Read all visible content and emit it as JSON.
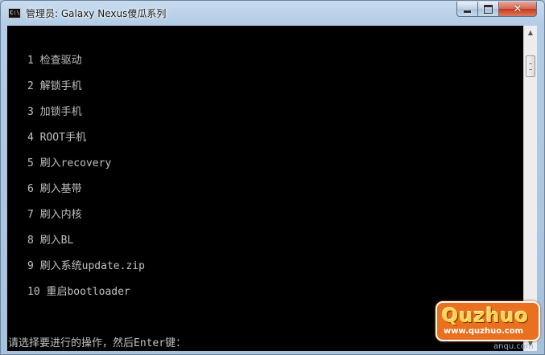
{
  "window": {
    "title": "管理员:  Galaxy Nexus傻瓜系列",
    "controls": {
      "minimize": "minimize",
      "maximize": "maximize",
      "close": "✕"
    }
  },
  "console": {
    "menu": [
      "1 检查驱动",
      "2 解锁手机",
      "3 加锁手机",
      "4 ROOT手机",
      "5 刷入recovery",
      "6 刷入基带",
      "7 刷入内核",
      "8 刷入BL",
      "9 刷入系统update.zip",
      "10 重启bootloader"
    ],
    "prompt": "请选择要进行的操作，然后Enter键："
  },
  "watermark": {
    "logo": "Quzhuo",
    "url": "www.quzhuo.com",
    "sub": "anqu.com"
  },
  "colors": {
    "console_bg": "#000000",
    "console_text": "#c0c0c0",
    "title_text": "#1b1b1b",
    "close_button": "#c2391f"
  },
  "icons": [
    "console-app-icon",
    "minimize-icon",
    "maximize-icon",
    "close-icon",
    "scroll-up-arrow-icon",
    "scroll-down-arrow-icon"
  ]
}
